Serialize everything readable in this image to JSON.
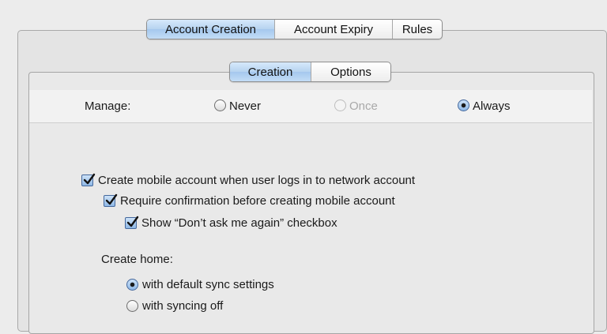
{
  "top_tabs": [
    {
      "label": "Account Creation",
      "selected": true
    },
    {
      "label": "Account Expiry",
      "selected": false
    },
    {
      "label": "Rules",
      "selected": false
    }
  ],
  "sub_tabs": [
    {
      "label": "Creation",
      "selected": true
    },
    {
      "label": "Options",
      "selected": false
    }
  ],
  "manage": {
    "label": "Manage:",
    "options": [
      {
        "label": "Never",
        "state": "unchecked"
      },
      {
        "label": "Once",
        "state": "disabled"
      },
      {
        "label": "Always",
        "state": "checked"
      }
    ]
  },
  "checkboxes": {
    "create_mobile": {
      "label": "Create mobile account when user logs in to network account",
      "checked": true
    },
    "require_confirmation": {
      "label": "Require confirmation before creating mobile account",
      "checked": true
    },
    "show_dont_ask": {
      "label": "Show “Don’t ask me again” checkbox",
      "checked": true
    }
  },
  "create_home": {
    "label": "Create home:",
    "options": [
      {
        "label": "with default sync settings",
        "checked": true
      },
      {
        "label": "with syncing off",
        "checked": false
      }
    ]
  },
  "colors": {
    "window_bg": "#ececec",
    "selected_tab": "#b6d3f0",
    "control_blue": "#8fb8e6"
  }
}
